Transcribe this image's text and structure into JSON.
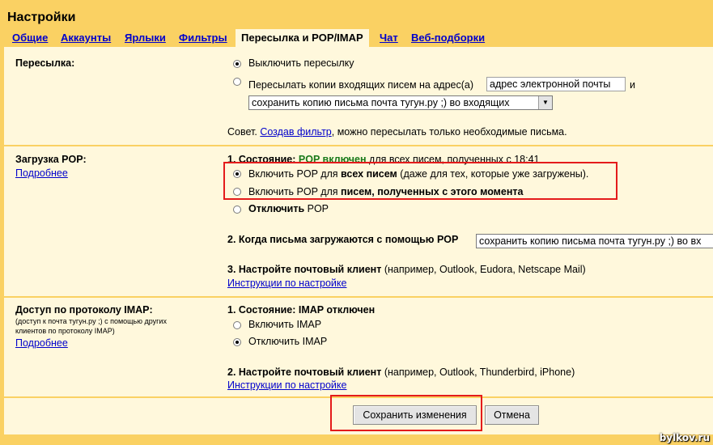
{
  "page_title": "Настройки",
  "tabs": [
    {
      "label": "Общие",
      "active": false
    },
    {
      "label": "Аккаунты",
      "active": false
    },
    {
      "label": "Ярлыки",
      "active": false
    },
    {
      "label": "Фильтры",
      "active": false
    },
    {
      "label": "Пересылка и POP/IMAP",
      "active": true
    },
    {
      "label": "Чат",
      "active": false
    },
    {
      "label": "Веб-подборки",
      "active": false
    }
  ],
  "forwarding": {
    "label": "Пересылка:",
    "option_off": "Выключить пересылку",
    "option_forward": "Пересылать копии входящих писем на адрес(а)",
    "address_placeholder": "адрес электронной почты",
    "and": "и",
    "keep_select_value": "сохранить копию письма почта тугун.ру ;) во входящих",
    "tip_prefix": "Совет.",
    "tip_link": "Создав фильтр",
    "tip_suffix": ", можно пересылать только необходимые письма."
  },
  "pop": {
    "label": "Загрузка POP:",
    "more_link": "Подробнее",
    "status_prefix": "1. Состояние:",
    "status_value": "POP включен",
    "status_suffix": "для всех писем, полученных с 18:41",
    "opt_all_prefix": "Включить POP для",
    "opt_all_bold": "всех писем",
    "opt_all_suffix": "(даже для тех, которые уже загружены).",
    "opt_new_prefix": "Включить POP для",
    "opt_new_bold": "писем, полученных с этого момента",
    "opt_off_bold": "Отключить",
    "opt_off_suffix": "POP",
    "when_label": "2. Когда письма загружаются с помощью POP",
    "when_value": "сохранить копию письма почта тугун.ру ;) во вх",
    "client_label": "3. Настройте почтовый клиент",
    "client_examples": "(например, Outlook, Eudora, Netscape Mail)",
    "instructions_link": "Инструкции по настройке"
  },
  "imap": {
    "label": "Доступ по протоколу IMAP:",
    "note": "(доступ к почта тугун.ру ;) с помощью других клиентов по протоколу IMAP)",
    "more_link": "Подробнее",
    "status": "1. Состояние: IMAP отключен",
    "opt_on": "Включить IMAP",
    "opt_off": "Отключить IMAP",
    "client_label": "2. Настройте почтовый клиент",
    "client_examples": "(например, Outlook, Thunderbird, iPhone)",
    "instructions_link": "Инструкции по настройке"
  },
  "actions": {
    "save": "Сохранить изменения",
    "cancel": "Отмена"
  },
  "watermark": "bylkov.ru",
  "colors": {
    "frame": "#fad163",
    "panel": "#fff8dc",
    "link": "#0000cc",
    "status_green": "#1a7a1a",
    "highlight_red": "#e41b1b"
  }
}
